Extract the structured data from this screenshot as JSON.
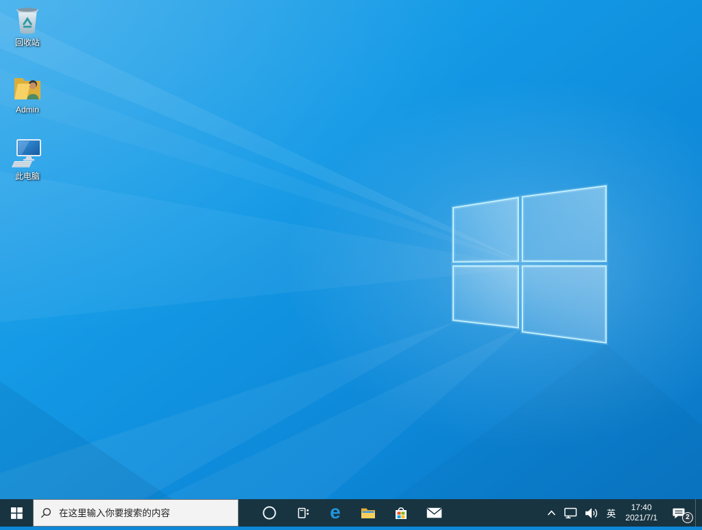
{
  "wallpaper": {
    "description": "Windows 10 default light-ray wallpaper with glowing window logo",
    "base_color": "#0d87d8",
    "logo_edge_color": "#bff0fe"
  },
  "desktop": {
    "icons": [
      {
        "id": "recycle-bin",
        "label": "回收站"
      },
      {
        "id": "admin-folder",
        "label": "Admin"
      },
      {
        "id": "this-pc",
        "label": "此电脑"
      }
    ]
  },
  "taskbar": {
    "background_color": "#183441",
    "search": {
      "placeholder": "在这里输入你要搜索的内容"
    },
    "edge_glyph": "e",
    "buttons": [
      {
        "id": "cortana",
        "icon": "cortana-circle-icon"
      },
      {
        "id": "task-view",
        "icon": "task-view-icon"
      },
      {
        "id": "edge",
        "icon": "edge-e-icon"
      },
      {
        "id": "file-explorer",
        "icon": "folder-icon"
      },
      {
        "id": "store",
        "icon": "store-bag-icon"
      },
      {
        "id": "mail",
        "icon": "mail-envelope-icon"
      }
    ],
    "tray": {
      "language": "英",
      "time": "17:40",
      "date": "2021/7/1",
      "notification_badge": "2"
    }
  }
}
